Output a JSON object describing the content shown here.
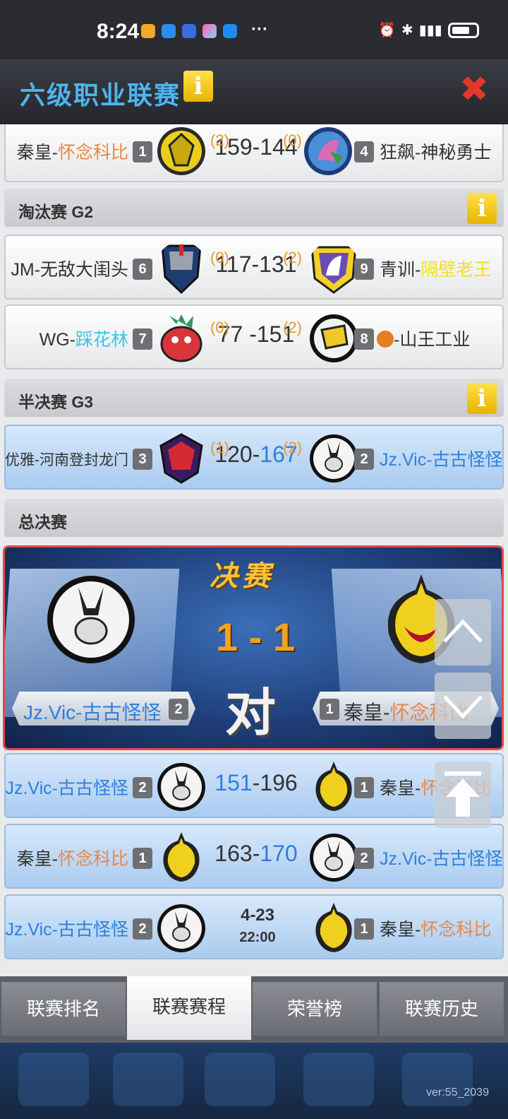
{
  "status": {
    "time": "8:24",
    "more": "···"
  },
  "header": {
    "title": "六级职业联赛",
    "info_icon": "info-icon",
    "close_icon": "close-icon"
  },
  "sections": {
    "g2": "淘汰赛 G2",
    "g3": "半决赛 G3",
    "final": "总决赛"
  },
  "matches_top": [
    {
      "left_prefix": "秦皇-",
      "left_hl": "怀念科比",
      "left_seed": "1",
      "left_wins": "(2)",
      "score_l": "159",
      "sep": "-",
      "score_r": "144",
      "right_wins": "(0)",
      "right_seed": "4",
      "right_name": "狂飙-神秘勇士"
    }
  ],
  "g2_matches": [
    {
      "left_name": "JM-无敌大闺头",
      "left_seed": "6",
      "left_wins": "(0)",
      "score_l": "117",
      "sep": "-",
      "score_r": "131",
      "right_wins": "(2)",
      "right_seed": "9",
      "right_prefix": "青训-",
      "right_hl": "隔壁老王"
    },
    {
      "left_prefix": "WG-",
      "left_hl": "踩花林",
      "left_seed": "7",
      "left_wins": "(0)",
      "score_l": "77",
      "sep": " -",
      "score_r": "151",
      "right_wins": "(2)",
      "right_seed": "8",
      "right_name": "-山王工业"
    }
  ],
  "g3_matches": [
    {
      "left_name": "优雅-河南登封龙门",
      "left_seed": "3",
      "left_wins": "(1)",
      "score_l": "120",
      "sep": "-",
      "score_r": "167",
      "right_wins": "(2)",
      "right_seed": "2",
      "right_name": "Jz.Vic-古古怪怪"
    }
  ],
  "final": {
    "heading": "决赛",
    "score": "1 - 1",
    "vs": "对",
    "left_name": "Jz.Vic-古古怪怪",
    "left_seed": "2",
    "right_seed": "1",
    "right_prefix": "秦皇-",
    "right_hl": "怀念科比"
  },
  "final_games": [
    {
      "left_name": "Jz.Vic-古古怪怪",
      "left_seed": "2",
      "score_l": "151",
      "sep": "-",
      "score_r": "196",
      "right_seed": "1",
      "right_prefix": "秦皇-",
      "right_hl": "怀念科比"
    },
    {
      "left_prefix": "秦皇-",
      "left_hl": "怀念科比",
      "left_seed": "1",
      "score_l": "163",
      "sep": "-",
      "score_r": "170",
      "right_seed": "2",
      "right_name": "Jz.Vic-古古怪怪"
    },
    {
      "left_name": "Jz.Vic-古古怪怪",
      "left_seed": "2",
      "date": "4-23",
      "time": "22:00",
      "right_seed": "1",
      "right_prefix": "秦皇-",
      "right_hl": "怀念科比"
    }
  ],
  "tabs": [
    "联赛排名",
    "联赛赛程",
    "荣誉榜",
    "联赛历史"
  ],
  "active_tab": "联赛赛程",
  "version": "ver:55_2039",
  "colors": {
    "title": "#4fb3f0",
    "highlight_blue": "#2f7fdb",
    "highlight_orange": "#e8874a",
    "wins": "#e39a2b",
    "final_border": "#e2484a"
  }
}
